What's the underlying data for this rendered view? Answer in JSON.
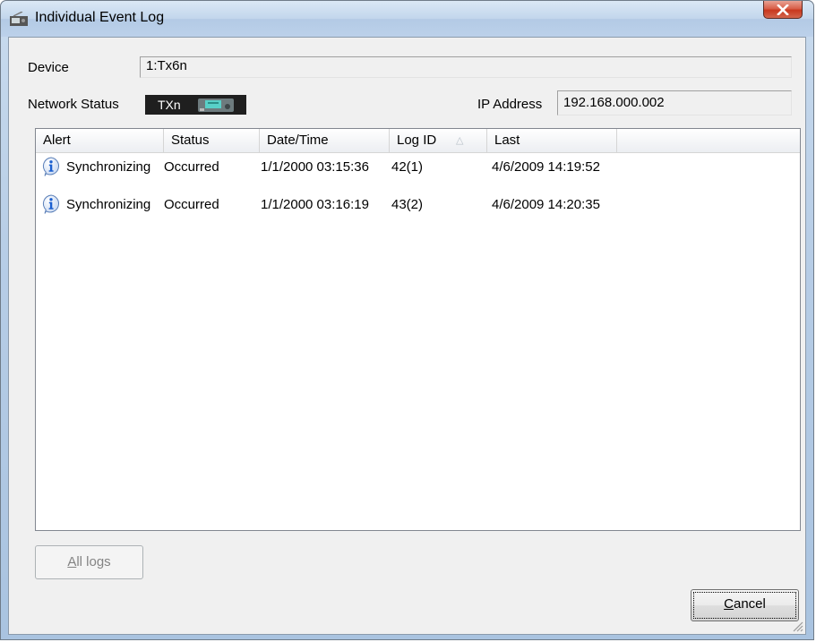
{
  "window": {
    "title": "Individual Event Log",
    "close_label": "X"
  },
  "device": {
    "label": "Device",
    "value": "1:Tx6n"
  },
  "network": {
    "label": "Network Status",
    "badge": "TXn",
    "ip_label": "IP Address",
    "ip_value": "192.168.000.002"
  },
  "table": {
    "columns": [
      "Alert",
      "Status",
      "Date/Time",
      "Log ID",
      "Last"
    ],
    "sorted_column": "Log ID",
    "sort_indicator": "△",
    "rows": [
      {
        "icon": "info-icon",
        "alert": "Synchronizing",
        "status": "Occurred",
        "datetime": "1/1/2000 03:15:36",
        "log_id": "42(1)",
        "last": "4/6/2009 14:19:52"
      },
      {
        "icon": "info-icon",
        "alert": "Synchronizing",
        "status": "Occurred",
        "datetime": "1/1/2000 03:16:19",
        "log_id": "43(2)",
        "last": "4/6/2009 14:20:35"
      }
    ]
  },
  "buttons": {
    "all_logs_mnemonic": "A",
    "all_logs_rest": "ll logs",
    "cancel_mnemonic": "C",
    "cancel_rest": "ancel"
  },
  "colors": {
    "info_icon": "#1a5fd0",
    "badge_bg": "#1f1f1f"
  }
}
